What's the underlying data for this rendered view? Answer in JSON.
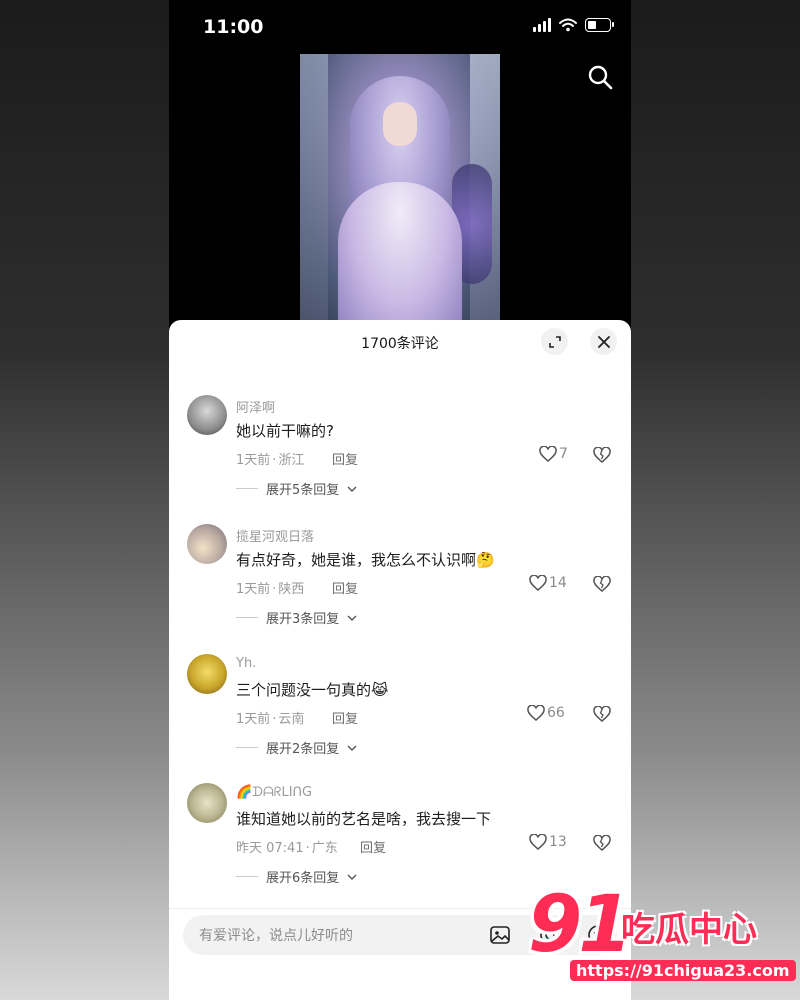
{
  "status_bar": {
    "time": "11:00"
  },
  "colors": {
    "accent": "#ff2d55",
    "sheet_bg": "#ffffff",
    "muted_text": "#9a9a9a",
    "primary_text": "#1d1d1d"
  },
  "comments_sheet": {
    "title": "1700条评论",
    "icons": {
      "expand": "expand-icon",
      "close": "close-icon"
    },
    "comments": [
      {
        "username": "阿泽啊",
        "text": "她以前干嘛的?",
        "time": "1天前",
        "location": "浙江",
        "reply_label": "回复",
        "likes": "7",
        "expand_label": "展开5条回复"
      },
      {
        "username": "揽星河观日落",
        "text": "有点好奇，她是谁，我怎么不认识啊🤔",
        "time": "1天前",
        "location": "陕西",
        "reply_label": "回复",
        "likes": "14",
        "expand_label": "展开3条回复"
      },
      {
        "username": "Yh.",
        "text": "三个问题没一句真的😹",
        "time": "1天前",
        "location": "云南",
        "reply_label": "回复",
        "likes": "66",
        "expand_label": "展开2条回复"
      },
      {
        "username": "🌈ᗪᗩᖇᒪIᑎG",
        "text": "谁知道她以前的艺名是啥，我去搜一下",
        "time": "昨天 07:41",
        "location": "广东",
        "reply_label": "回复",
        "likes": "13",
        "expand_label": "展开6条回复"
      }
    ]
  },
  "input": {
    "placeholder": "有爱评论，说点儿好听的"
  },
  "watermark": {
    "number": "91",
    "brand": "吃瓜中心",
    "url": "https://91chigua23.com"
  }
}
